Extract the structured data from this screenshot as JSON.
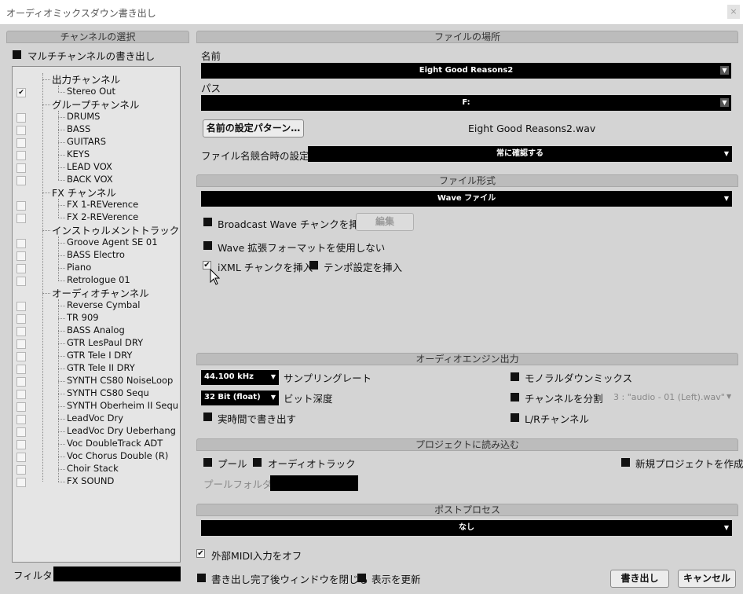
{
  "window": {
    "title": "オーディオミックスダウン書き出し",
    "close_icon": "×"
  },
  "channel_select": {
    "header": "チャンネルの選択",
    "multichannel_label": "マルチチャンネルの書き出し",
    "filter_label": "フィルター",
    "filter_value": "",
    "groups": [
      {
        "label": "出力チャンネル",
        "items": [
          {
            "label": "Stereo Out",
            "checked": true
          }
        ]
      },
      {
        "label": "グループチャンネル",
        "items": [
          {
            "label": "DRUMS",
            "checked": false
          },
          {
            "label": "BASS",
            "checked": false
          },
          {
            "label": "GUITARS",
            "checked": false
          },
          {
            "label": "KEYS",
            "checked": false
          },
          {
            "label": "LEAD VOX",
            "checked": false
          },
          {
            "label": "BACK VOX",
            "checked": false
          }
        ]
      },
      {
        "label": "FX チャンネル",
        "items": [
          {
            "label": "FX 1-REVerence",
            "checked": false
          },
          {
            "label": "FX 2-REVerence",
            "checked": false
          }
        ]
      },
      {
        "label": "インストゥルメントトラック",
        "items": [
          {
            "label": "Groove Agent SE 01",
            "checked": false
          },
          {
            "label": "BASS Electro",
            "checked": false
          },
          {
            "label": "Piano",
            "checked": false
          },
          {
            "label": "Retrologue 01",
            "checked": false
          }
        ]
      },
      {
        "label": "オーディオチャンネル",
        "items": [
          {
            "label": "Reverse Cymbal",
            "checked": false
          },
          {
            "label": "TR 909",
            "checked": false
          },
          {
            "label": "BASS Analog",
            "checked": false
          },
          {
            "label": "GTR LesPaul DRY",
            "checked": false
          },
          {
            "label": "GTR Tele I DRY",
            "checked": false
          },
          {
            "label": "GTR Tele II DRY",
            "checked": false
          },
          {
            "label": "SYNTH CS80 NoiseLoop",
            "checked": false
          },
          {
            "label": "SYNTH CS80 Sequ",
            "checked": false
          },
          {
            "label": "SYNTH Oberheim II Sequ",
            "checked": false
          },
          {
            "label": "LeadVoc Dry",
            "checked": false
          },
          {
            "label": "LeadVoc Dry Ueberhang",
            "checked": false
          },
          {
            "label": "Voc DoubleTrack ADT",
            "checked": false
          },
          {
            "label": "Voc Chorus Double (R)",
            "checked": false
          },
          {
            "label": "Choir Stack",
            "checked": false
          },
          {
            "label": "FX SOUND",
            "checked": false
          }
        ]
      }
    ]
  },
  "file_location": {
    "header": "ファイルの場所",
    "name_label": "名前",
    "name_value": "Eight Good Reasons2",
    "path_label": "パス",
    "path_value": "F:",
    "naming_pattern_button": "名前の設定パターン…",
    "filename_preview": "Eight Good Reasons2.wav",
    "conflict_label": "ファイル名競合時の設定",
    "conflict_value": "常に確認する"
  },
  "file_format": {
    "header": "ファイル形式",
    "format_value": "Wave ファイル",
    "broadcast_label": "Broadcast Wave チャンクを挿入",
    "edit_button": "編集",
    "no_extended_label": "Wave 拡張フォーマットを使用しない",
    "ixml_label": "iXML チャンクを挿入",
    "ixml_checked": true,
    "tempo_label": "テンポ設定を挿入"
  },
  "audio_engine": {
    "header": "オーディオエンジン出力",
    "sample_rate_value": "44.100 kHz",
    "sample_rate_label": "サンプリングレート",
    "bit_depth_value": "32 Bit (float)",
    "bit_depth_label": "ビット深度",
    "realtime_label": "実時間で書き出す",
    "mono_label": "モノラルダウンミックス",
    "split_label": "チャンネルを分割",
    "split_preview": "3 : \"audio - 01 (Left).wav\"",
    "lr_label": "L/Rチャンネル"
  },
  "import_project": {
    "header": "プロジェクトに読み込む",
    "pool_label": "プール",
    "audio_track_label": "オーディオトラック",
    "new_project_label": "新規プロジェクトを作成",
    "pool_folder_label": "プールフォルダー",
    "pool_folder_value": ""
  },
  "post_process": {
    "header": "ポストプロセス",
    "value": "なし"
  },
  "footer": {
    "midi_off_label": "外部MIDI入力をオフ",
    "midi_off_checked": true,
    "close_after_label": "書き出し完了後ウィンドウを閉じる",
    "update_display_label": "表示を更新",
    "export_button": "書き出し",
    "cancel_button": "キャンセル"
  },
  "colors": {
    "panel_header": "#bcbcbc",
    "background": "#d4d4d4",
    "field": "#000000"
  }
}
